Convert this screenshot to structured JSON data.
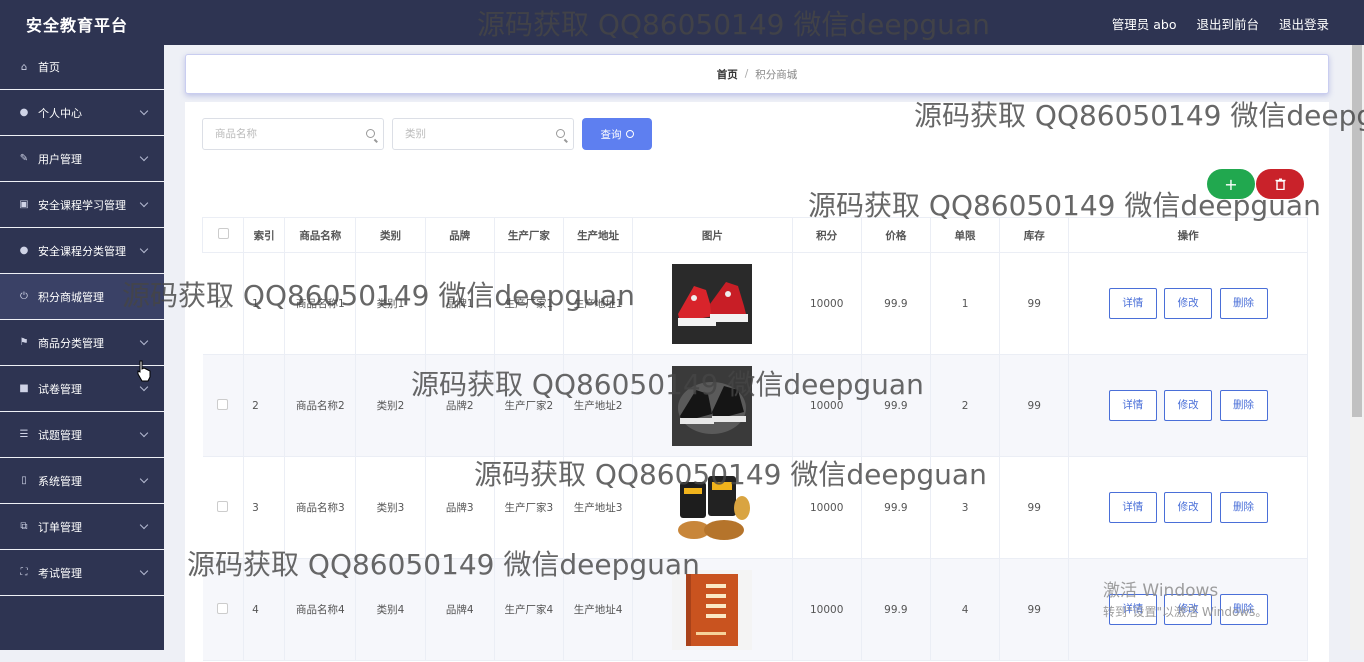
{
  "header": {
    "title": "安全教育平台",
    "admin": "管理员 abo",
    "front": "退出到前台",
    "logout": "退出登录"
  },
  "sidebar": {
    "items": [
      {
        "label": "首页",
        "icon": "home-icon"
      },
      {
        "label": "个人中心",
        "icon": "user-icon"
      },
      {
        "label": "用户管理",
        "icon": "pen-icon"
      },
      {
        "label": "安全课程学习管理",
        "icon": "clipboard-icon"
      },
      {
        "label": "安全课程分类管理",
        "icon": "user-icon"
      },
      {
        "label": "积分商城管理",
        "icon": "power-icon"
      },
      {
        "label": "商品分类管理",
        "icon": "flag-icon"
      },
      {
        "label": "试卷管理",
        "icon": "briefcase-icon"
      },
      {
        "label": "试题管理",
        "icon": "list-icon"
      },
      {
        "label": "系统管理",
        "icon": "phone-icon"
      },
      {
        "label": "订单管理",
        "icon": "copy-icon"
      },
      {
        "label": "考试管理",
        "icon": "expand-icon"
      }
    ]
  },
  "breadcrumb": {
    "home": "首页",
    "current": "积分商城"
  },
  "search": {
    "name_placeholder": "商品名称",
    "category_placeholder": "类别",
    "query_label": "查询"
  },
  "toolbar": {
    "add": "+"
  },
  "table": {
    "headers": [
      "索引",
      "商品名称",
      "类别",
      "品牌",
      "生产厂家",
      "生产地址",
      "图片",
      "积分",
      "价格",
      "单限",
      "库存",
      "操作"
    ],
    "rows": [
      {
        "idx": "1",
        "name": "商品名称1",
        "cat": "类别1",
        "brand": "品牌1",
        "maker": "生产厂家1",
        "addr": "生产地址1",
        "points": "10000",
        "price": "99.9",
        "limit": "1",
        "stock": "99"
      },
      {
        "idx": "2",
        "name": "商品名称2",
        "cat": "类别2",
        "brand": "品牌2",
        "maker": "生产厂家2",
        "addr": "生产地址2",
        "points": "10000",
        "price": "99.9",
        "limit": "2",
        "stock": "99"
      },
      {
        "idx": "3",
        "name": "商品名称3",
        "cat": "类别3",
        "brand": "品牌3",
        "maker": "生产厂家3",
        "addr": "生产地址3",
        "points": "10000",
        "price": "99.9",
        "limit": "3",
        "stock": "99"
      },
      {
        "idx": "4",
        "name": "商品名称4",
        "cat": "类别4",
        "brand": "品牌4",
        "maker": "生产厂家4",
        "addr": "生产地址4",
        "points": "10000",
        "price": "99.9",
        "limit": "4",
        "stock": "99"
      }
    ],
    "actions": {
      "detail": "详情",
      "edit": "修改",
      "delete": "删除"
    }
  },
  "watermark": "源码获取 QQ86050149 微信deepguan",
  "activation": {
    "line1": "激活 Windows",
    "line2": "转到\"设置\"以激活 Windows。"
  },
  "colors": {
    "sidebar": "#2e3452",
    "primary": "#5e7ff0",
    "add": "#21a84f",
    "delete": "#c9222a"
  }
}
